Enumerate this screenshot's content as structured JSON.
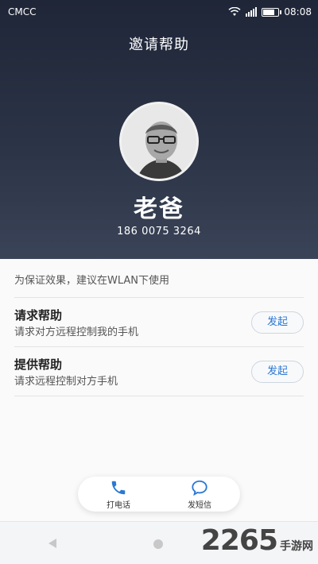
{
  "status_bar": {
    "carrier": "CMCC",
    "time": "08:08"
  },
  "header": {
    "title": "邀请帮助"
  },
  "contact": {
    "name": "老爸",
    "phone": "186 0075 3264"
  },
  "hint": "为保证效果，建议在WLAN下使用",
  "options": [
    {
      "title": "请求帮助",
      "description": "请求对方远程控制我的手机",
      "button": "发起"
    },
    {
      "title": "提供帮助",
      "description": "请求远程控制对方手机",
      "button": "发起"
    }
  ],
  "actions": [
    {
      "label": "打电话",
      "icon": "phone-icon"
    },
    {
      "label": "发短信",
      "icon": "message-icon"
    }
  ],
  "watermark": {
    "number": "2265",
    "site": "手游网"
  },
  "colors": {
    "accent": "#2b78d4",
    "hero_top": "#1f2638",
    "hero_bottom": "#3a4357"
  }
}
